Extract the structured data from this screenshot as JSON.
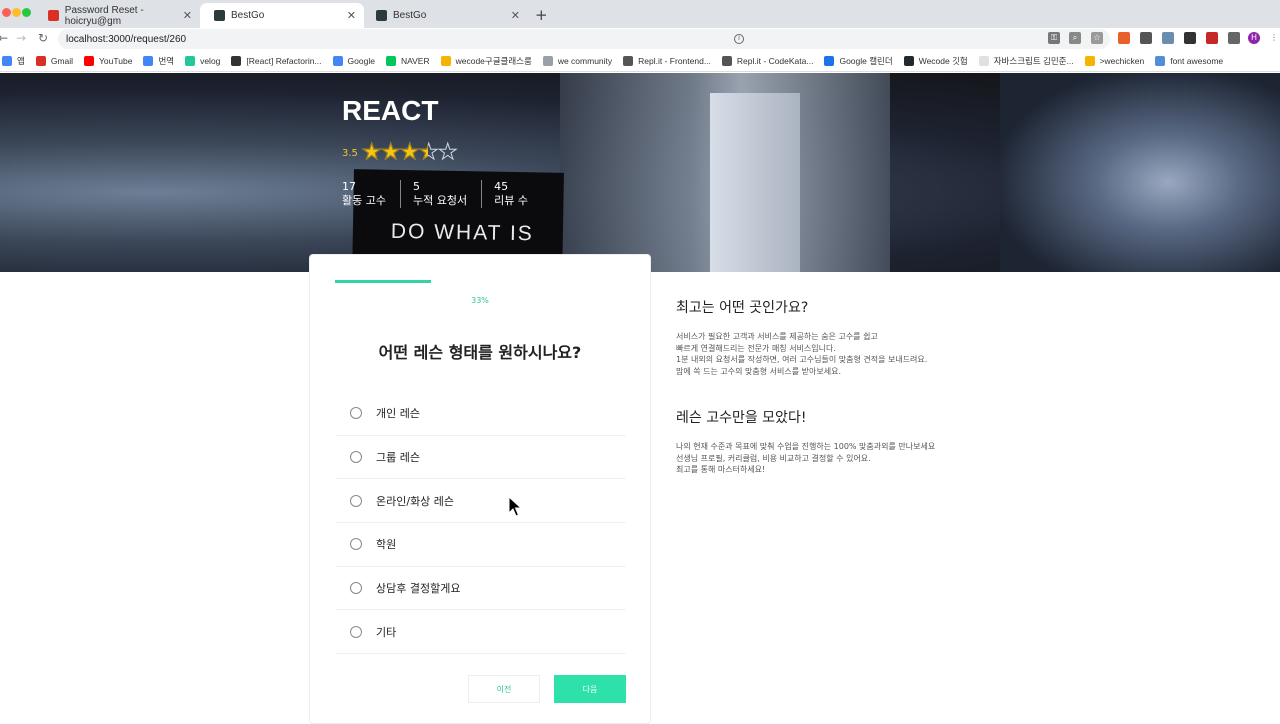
{
  "browser": {
    "tabs": [
      {
        "title": "Password Reset - hoicryu@gm",
        "favicon_color": "#d93025"
      },
      {
        "title": "BestGo",
        "favicon_color": "#2b3a3a"
      },
      {
        "title": "BestGo",
        "favicon_color": "#2b3a3a"
      }
    ],
    "address": "localhost:3000/request/260",
    "profile_initial": "H",
    "bookmarks": [
      {
        "label": "앱",
        "color": "#4285f4"
      },
      {
        "label": "Gmail",
        "color": "#d93025"
      },
      {
        "label": "YouTube",
        "color": "#ff0000"
      },
      {
        "label": "번역",
        "color": "#4285f4"
      },
      {
        "label": "velog",
        "color": "#20c997"
      },
      {
        "label": "[React] Refactorin...",
        "color": "#333333"
      },
      {
        "label": "Google",
        "color": "#4285f4"
      },
      {
        "label": "NAVER",
        "color": "#03c75a"
      },
      {
        "label": "wecode구글클래스룸",
        "color": "#f4b400"
      },
      {
        "label": "we community",
        "color": "#9aa0a6"
      },
      {
        "label": "Repl.it - Frontend...",
        "color": "#555555"
      },
      {
        "label": "Repl.it - CodeKata...",
        "color": "#555555"
      },
      {
        "label": "Google 캘린더",
        "color": "#1a73e8"
      },
      {
        "label": "Wecode 깃헙",
        "color": "#24292e"
      },
      {
        "label": "자바스크립트 김민준...",
        "color": "#e0e0e0"
      },
      {
        "label": ">wechicken",
        "color": "#f4b400"
      },
      {
        "label": "font awesome",
        "color": "#528dd7"
      }
    ]
  },
  "hero": {
    "title": "REACT",
    "rating_text": "3.5",
    "rating": 3.5,
    "rating_max": 5,
    "screen_text": "DO WHAT IS",
    "stats": [
      {
        "value": "17",
        "label": "활동 고수"
      },
      {
        "value": "5",
        "label": "누적 요청서"
      },
      {
        "value": "45",
        "label": "리뷰 수"
      }
    ]
  },
  "form": {
    "progress_label": "33%",
    "progress": 0.33,
    "question": "어떤 레슨 형태를 원하시나요?",
    "options": [
      "개인 레슨",
      "그룹 레슨",
      "온라인/화상 레슨",
      "학원",
      "상담후 결정할게요",
      "기타"
    ],
    "prev_label": "이전",
    "next_label": "다음"
  },
  "side": {
    "block1_title": "최고는 어떤 곳인가요?",
    "block1_lines": [
      "서비스가 필요한 고객과 서비스를 제공하는 숨은 고수를 쉽고",
      "빠르게 연결해드리는 전문가 매칭 서비스입니다.",
      "1분 내외의 요청서를 작성하면, 여러 고수님들이 맞춤형 견적을 보내드려요.",
      "맘에 쏙 드는 고수의 맞춤형 서비스를 받아보세요."
    ],
    "block2_title": "레슨 고수만을 모았다!",
    "block2_lines": [
      "나의 현재 수준과 목표에 맞춰 수업을 진행하는 100% 맞춤과외를 만나보세요",
      "선생님 프로필, 커리큘럼, 비용 비교하고 결정할 수 있어요.",
      "최고를 통해 마스터하세요!"
    ]
  },
  "colors": {
    "accent": "#2ee0aa",
    "star": "#f5c518"
  }
}
